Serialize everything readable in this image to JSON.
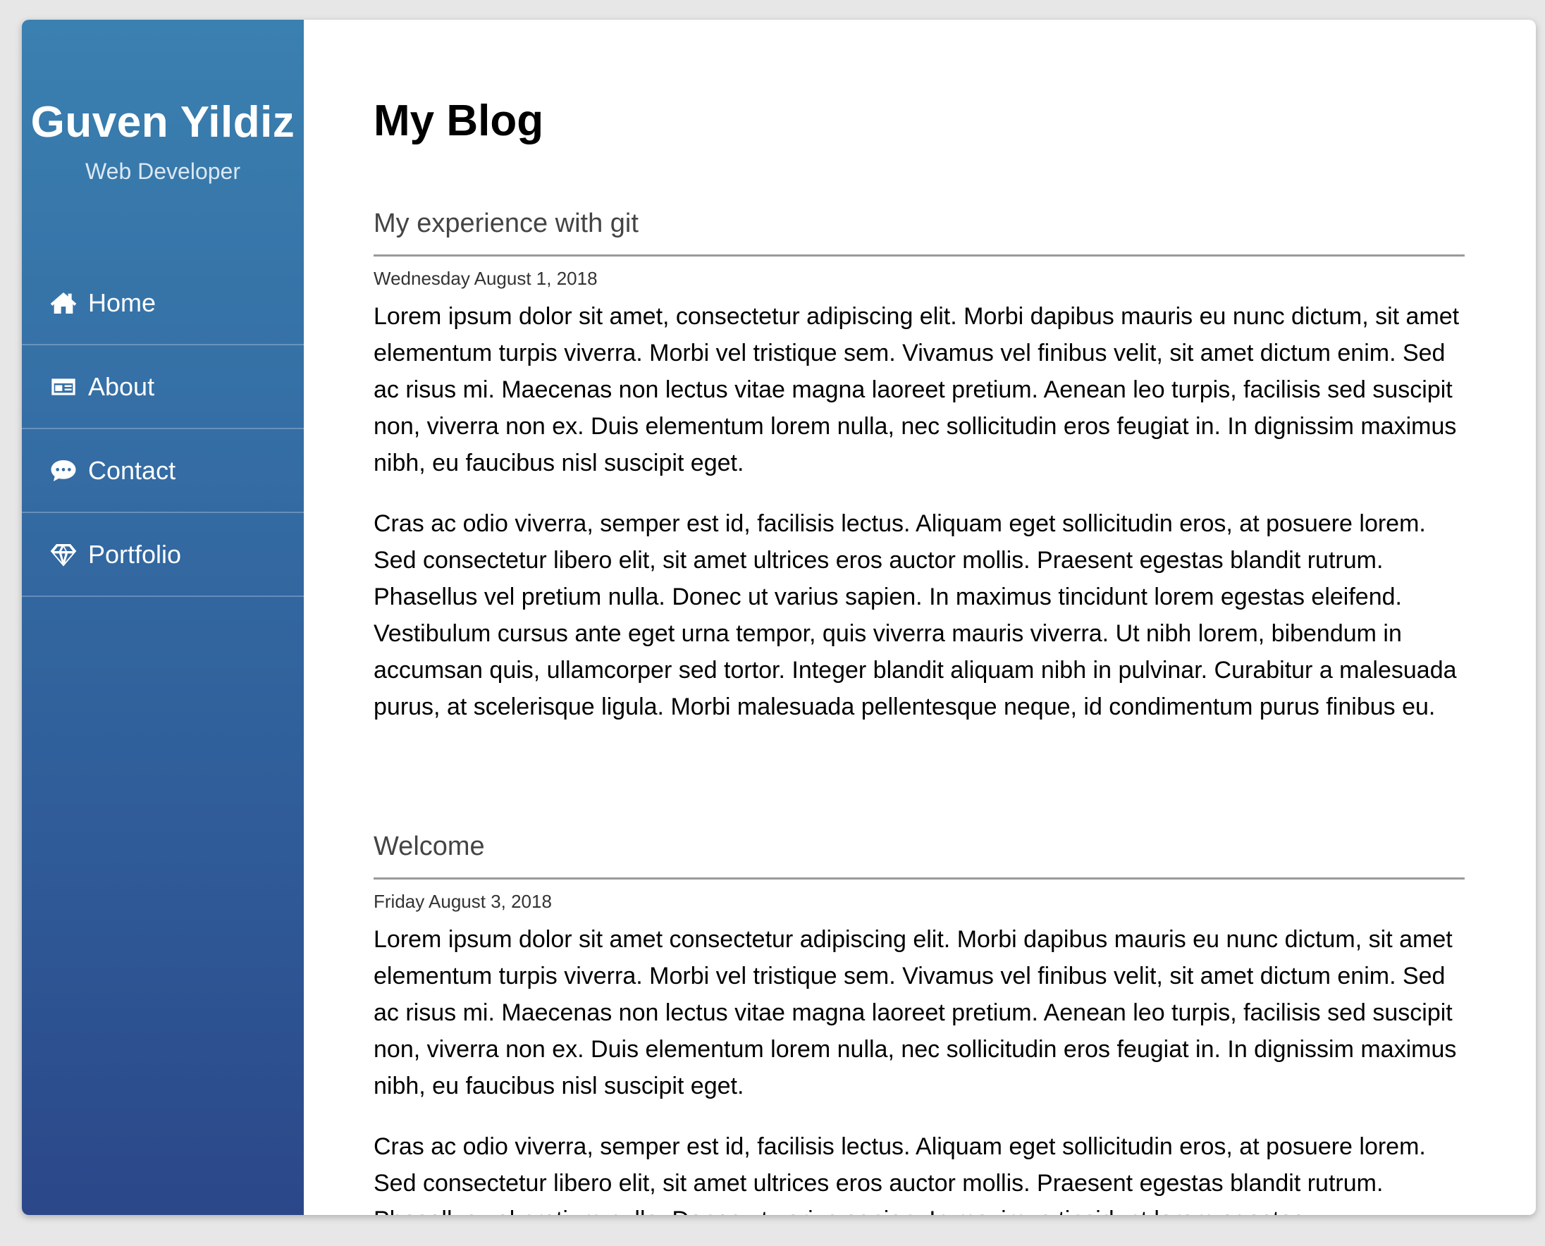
{
  "sidebar": {
    "name": "Guven Yildiz",
    "role": "Web Developer",
    "nav": [
      {
        "label": "Home",
        "icon": "home-icon"
      },
      {
        "label": "About",
        "icon": "id-card-icon"
      },
      {
        "label": "Contact",
        "icon": "chat-bubble-icon"
      },
      {
        "label": "Portfolio",
        "icon": "diamond-icon"
      }
    ]
  },
  "main": {
    "title": "My Blog",
    "posts": [
      {
        "title": "My experience with git",
        "date": "Wednesday August 1, 2018",
        "paragraphs": [
          "Lorem ipsum dolor sit amet, consectetur adipiscing elit. Morbi dapibus mauris eu nunc dictum, sit amet elementum turpis viverra. Morbi vel tristique sem. Vivamus vel finibus velit, sit amet dictum enim. Sed ac risus mi. Maecenas non lectus vitae magna laoreet pretium. Aenean leo turpis, facilisis sed suscipit non, viverra non ex. Duis elementum lorem nulla, nec sollicitudin eros feugiat in. In dignissim maximus nibh, eu faucibus nisl suscipit eget.",
          "Cras ac odio viverra, semper est id, facilisis lectus. Aliquam eget sollicitudin eros, at posuere lorem. Sed consectetur libero elit, sit amet ultrices eros auctor mollis. Praesent egestas blandit rutrum. Phasellus vel pretium nulla. Donec ut varius sapien. In maximus tincidunt lorem egestas eleifend. Vestibulum cursus ante eget urna tempor, quis viverra mauris viverra. Ut nibh lorem, bibendum in accumsan quis, ullamcorper sed tortor. Integer blandit aliquam nibh in pulvinar. Curabitur a malesuada purus, at scelerisque ligula. Morbi malesuada pellentesque neque, id condimentum purus finibus eu."
        ]
      },
      {
        "title": "Welcome",
        "date": "Friday August 3, 2018",
        "paragraphs": [
          "Lorem ipsum dolor sit amet consectetur adipiscing elit. Morbi dapibus mauris eu nunc dictum, sit amet elementum turpis viverra. Morbi vel tristique sem. Vivamus vel finibus velit, sit amet dictum enim. Sed ac risus mi. Maecenas non lectus vitae magna laoreet pretium. Aenean leo turpis, facilisis sed suscipit non, viverra non ex. Duis elementum lorem nulla, nec sollicitudin eros feugiat in. In dignissim maximus nibh, eu faucibus nisl suscipit eget.",
          "Cras ac odio viverra, semper est id, facilisis lectus. Aliquam eget sollicitudin eros, at posuere lorem. Sed consectetur libero elit, sit amet ultrices eros auctor mollis. Praesent egestas blandit rutrum. Phasellus vel pretium nulla. Donec ut varius sapien. In maximus tincidunt lorem egestas"
        ]
      }
    ]
  },
  "colors": {
    "sidebar_top": "#3a80b0",
    "sidebar_bottom": "#2b4789",
    "background": "#e7e7e7"
  }
}
